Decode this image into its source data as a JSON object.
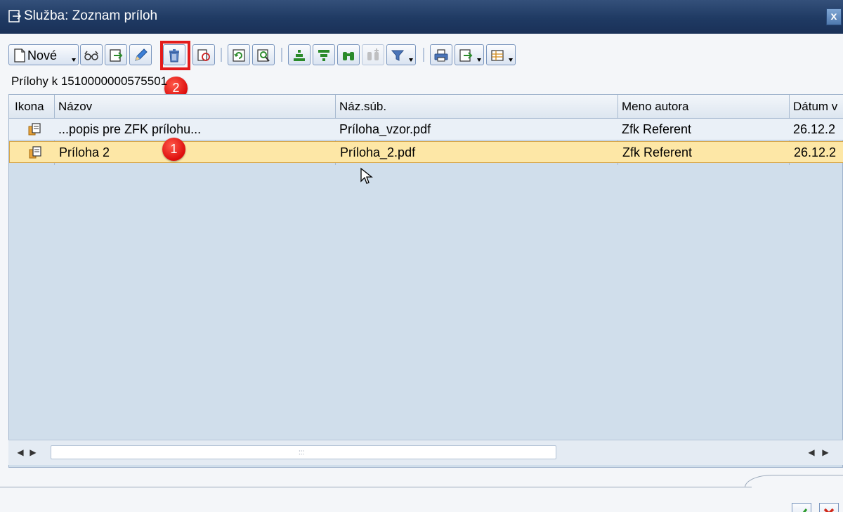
{
  "window": {
    "title": "Služba: Zoznam príloh",
    "close_label": "x"
  },
  "toolbar": {
    "new_label": "Nové",
    "icons": [
      "new-icon",
      "display-icon",
      "import-icon",
      "edit-pencil-icon",
      "delete-trash-icon",
      "check-icon",
      "refresh-icon",
      "find-icon",
      "sort-ascending-icon",
      "filter-list-icon",
      "binoculars-icon",
      "find-next-icon",
      "filter-icon",
      "print-icon",
      "export-icon",
      "layout-grid-icon"
    ]
  },
  "annotations": {
    "badge_1": "1",
    "badge_2": "2"
  },
  "caption": "Prílohy k 1510000000575501",
  "grid": {
    "columns": [
      "Ikona",
      "Názov",
      "Náz.súb.",
      "Meno autora",
      "Dátum v"
    ],
    "rows": [
      {
        "name": "...popis pre ZFK prílohu...",
        "file": "Príloha_vzor.pdf",
        "author": "Zfk Referent",
        "date": "26.12.2"
      },
      {
        "name": "Príloha 2",
        "file": "Príloha_2.pdf",
        "author": "Zfk Referent",
        "date": "26.12.2"
      }
    ],
    "selected_row": 2
  },
  "colors": {
    "title_bar": "#1f3a63",
    "grid_background": "#d0deeb",
    "selected_row": "#fde7a6",
    "highlight": "#e31b1b"
  }
}
